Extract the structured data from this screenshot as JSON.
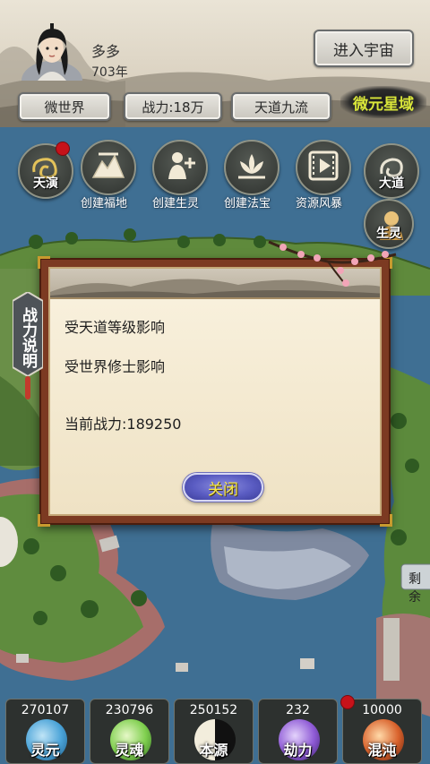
{
  "player": {
    "name": "多多",
    "age": "703年"
  },
  "header": {
    "enter_button": "进入宇宙",
    "tags": [
      "微世界",
      "战力:18万",
      "天道九流"
    ],
    "realm": "微元星域"
  },
  "actions": [
    {
      "label": "天演",
      "icon": "swirl-cloud-icon",
      "badge": true
    },
    {
      "label": "创建福地",
      "icon": "mountain-icon",
      "badge": false
    },
    {
      "label": "创建生灵",
      "icon": "person-plus-icon",
      "badge": false
    },
    {
      "label": "创建法宝",
      "icon": "lotus-icon",
      "badge": false
    },
    {
      "label": "资源风暴",
      "icon": "film-play-icon",
      "badge": false
    },
    {
      "label": "大道",
      "icon": "dao-symbol-icon",
      "badge": false
    },
    {
      "label": "生灵",
      "icon": "creature-portrait-icon",
      "badge": false
    }
  ],
  "dialog": {
    "side_title": "战力说明",
    "line1": "受天道等级影响",
    "line2": "受世界修士影响",
    "power_line": "当前战力:189250",
    "close_button": "关闭"
  },
  "side_peek": {
    "right_label": "剩余"
  },
  "resources": [
    {
      "count": "270107",
      "label": "灵元",
      "color": "#4aa3d8",
      "badge": false
    },
    {
      "count": "230796",
      "label": "灵魂",
      "color": "#7fcf4e",
      "badge": false
    },
    {
      "count": "250152",
      "label": "本源",
      "color": "#e8e2c8",
      "badge": false
    },
    {
      "count": "232",
      "label": "劫力",
      "color": "#8f5bd6",
      "badge": false
    },
    {
      "count": "10000",
      "label": "混沌",
      "color": "#d9622c",
      "badge": true
    }
  ]
}
